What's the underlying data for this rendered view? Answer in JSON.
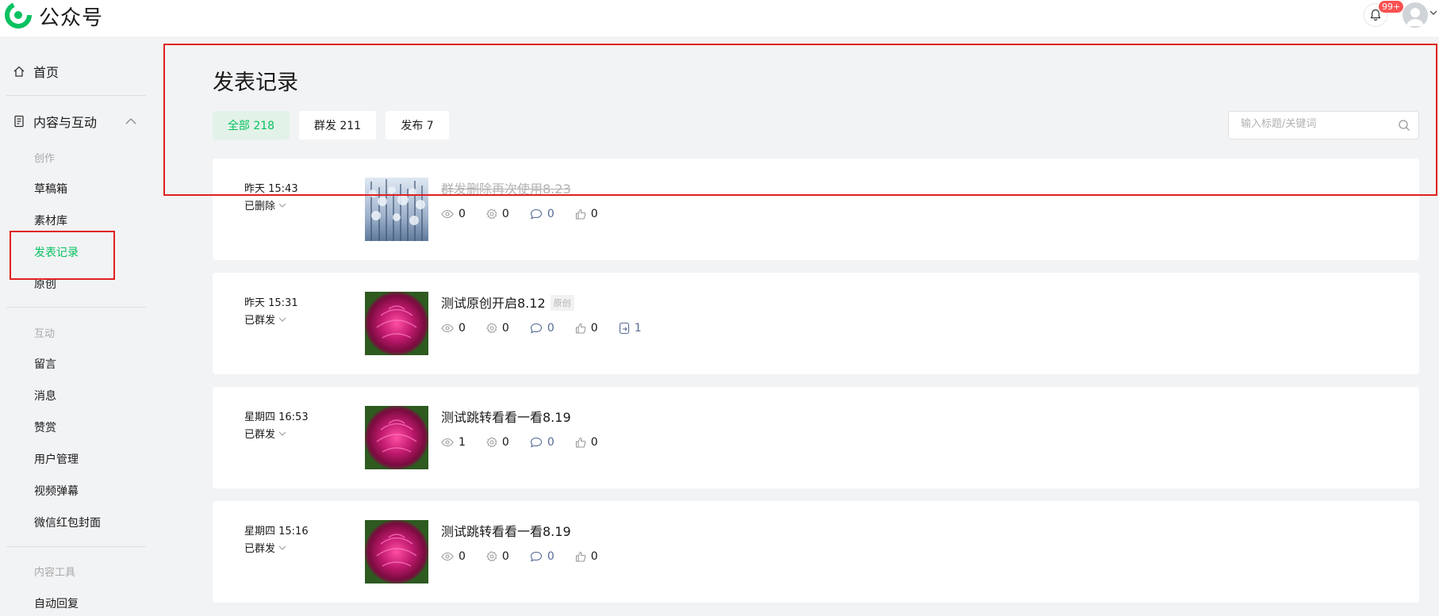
{
  "header": {
    "brand": "公众号",
    "notification_badge": "99+"
  },
  "sidebar": {
    "home": "首页",
    "section": "内容与互动",
    "group_create": "创作",
    "create_items": [
      "草稿箱",
      "素材库",
      "发表记录",
      "原创"
    ],
    "group_interact": "互动",
    "interact_items": [
      "留言",
      "消息",
      "赞赏",
      "用户管理",
      "视频弹幕",
      "微信红包封面"
    ],
    "group_tools": "内容工具",
    "tool_items": [
      "自动回复"
    ],
    "active": "发表记录"
  },
  "main": {
    "title": "发表记录",
    "tabs": [
      "全部 218",
      "群发 211",
      "发布 7"
    ],
    "search_placeholder": "输入标题/关键词"
  },
  "records": [
    {
      "time": "昨天 15:43",
      "status": "已删除",
      "title": "群发删除再次使用8.23",
      "deleted": true,
      "reads": "0",
      "shares": "0",
      "comments": "0",
      "likes": "0",
      "image": "snowy-forest"
    },
    {
      "time": "昨天 15:31",
      "status": "已群发",
      "title": "测试原创开启8.12",
      "tag": "原创",
      "reads": "0",
      "shares": "0",
      "comments": "0",
      "likes": "0",
      "reposts": "1",
      "image": "pink-flower"
    },
    {
      "time": "星期四 16:53",
      "status": "已群发",
      "title": "测试跳转看看一看8.19",
      "reads": "1",
      "shares": "0",
      "comments": "0",
      "likes": "0",
      "image": "pink-flower"
    },
    {
      "time": "星期四 15:16",
      "status": "已群发",
      "title": "测试跳转看看一看8.19",
      "reads": "0",
      "shares": "0",
      "comments": "0",
      "likes": "0",
      "image": "pink-flower"
    }
  ],
  "colors": {
    "accent": "#07c160",
    "link_blue": "#576b95",
    "annotation_red": "#e02020"
  }
}
